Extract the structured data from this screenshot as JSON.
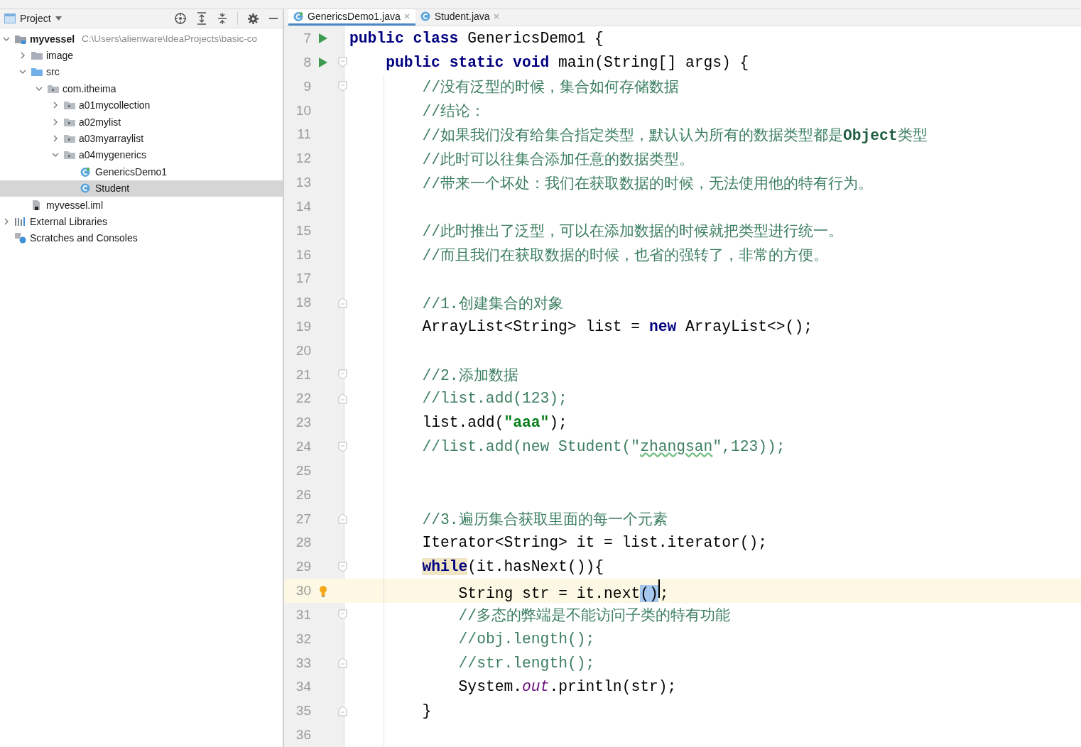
{
  "project_panel": {
    "title": "Project",
    "tree": [
      {
        "label": "myvessel",
        "kind": "module",
        "path": "C:\\Users\\alienware\\IdeaProjects\\basic-co",
        "expanded": true,
        "selected": false,
        "children": [
          {
            "label": "image",
            "kind": "folder",
            "expanded": false,
            "selected": false
          },
          {
            "label": "src",
            "kind": "source-folder",
            "expanded": true,
            "selected": false,
            "children": [
              {
                "label": "com.itheima",
                "kind": "package",
                "expanded": true,
                "selected": false,
                "children": [
                  {
                    "label": "a01mycollection",
                    "kind": "package",
                    "expanded": false,
                    "selected": false
                  },
                  {
                    "label": "a02mylist",
                    "kind": "package",
                    "expanded": false,
                    "selected": false
                  },
                  {
                    "label": "a03myarraylist",
                    "kind": "package",
                    "expanded": false,
                    "selected": false
                  },
                  {
                    "label": "a04mygenerics",
                    "kind": "package",
                    "expanded": true,
                    "selected": false,
                    "children": [
                      {
                        "label": "GenericsDemo1",
                        "kind": "main-class",
                        "selected": false
                      },
                      {
                        "label": "Student",
                        "kind": "class",
                        "selected": true
                      }
                    ]
                  }
                ]
              }
            ]
          },
          {
            "label": "myvessel.iml",
            "kind": "iml-file",
            "selected": false
          }
        ]
      },
      {
        "label": "External Libraries",
        "kind": "libraries",
        "expanded": false,
        "selected": false
      },
      {
        "label": "Scratches and Consoles",
        "kind": "scratches",
        "selected": false
      }
    ]
  },
  "tabs": [
    {
      "label": "GenericsDemo1.java",
      "kind": "main-class",
      "selected": true
    },
    {
      "label": "Student.java",
      "kind": "class",
      "selected": false
    }
  ],
  "editor": {
    "lines": [
      {
        "number": "7",
        "kind": "top",
        "gutter_icon": {
          "kind": "run"
        },
        "tokens": [
          {
            "kind": "keyword",
            "text": "public class"
          },
          {
            "kind": "plain",
            "text": " GenericsDemo1 {"
          }
        ]
      },
      {
        "number": "8",
        "kind": "member",
        "gutter_icon": {
          "kind": "run"
        },
        "fold_marker": {
          "kind": "start"
        },
        "tokens": [
          {
            "kind": "keyword",
            "text": "public static void"
          },
          {
            "kind": "plain",
            "text": " main(String[] args) {"
          }
        ]
      },
      {
        "number": "9",
        "kind": "body",
        "fold_marker": {
          "kind": "start"
        },
        "tokens": [
          {
            "kind": "comment",
            "text": "//没有泛型的时候，集合如何存储数据"
          }
        ]
      },
      {
        "number": "10",
        "kind": "body",
        "tokens": [
          {
            "kind": "comment",
            "text": "//结论："
          }
        ]
      },
      {
        "number": "11",
        "kind": "body",
        "tokens": [
          {
            "kind": "comment",
            "text": "//如果我们没有给集合指定类型，默认认为所有的数据类型都是"
          },
          {
            "kind": "comment-code",
            "text": "Object"
          },
          {
            "kind": "comment",
            "text": "类型"
          }
        ]
      },
      {
        "number": "12",
        "kind": "body",
        "tokens": [
          {
            "kind": "comment",
            "text": "//此时可以往集合添加任意的数据类型。"
          }
        ]
      },
      {
        "number": "13",
        "kind": "body",
        "tokens": [
          {
            "kind": "comment",
            "text": "//带来一个坏处：我们在获取数据的时候，无法使用他的特有行为。"
          }
        ]
      },
      {
        "number": "14"
      },
      {
        "number": "15",
        "kind": "body",
        "tokens": [
          {
            "kind": "comment",
            "text": "//此时推出了泛型，可以在添加数据的时候就把类型进行统一。"
          }
        ]
      },
      {
        "number": "16",
        "kind": "body",
        "tokens": [
          {
            "kind": "comment",
            "text": "//而且我们在获取数据的时候，也省的强转了，非常的方便。"
          }
        ]
      },
      {
        "number": "17"
      },
      {
        "number": "18",
        "kind": "body",
        "fold_marker": {
          "kind": "end"
        },
        "tokens": [
          {
            "kind": "comment",
            "text": "//1.创建集合的对象"
          }
        ]
      },
      {
        "number": "19",
        "kind": "body",
        "tokens": [
          {
            "kind": "plain",
            "text": "ArrayList<String> list = "
          },
          {
            "kind": "keyword",
            "text": "new"
          },
          {
            "kind": "plain",
            "text": " ArrayList<>();"
          }
        ]
      },
      {
        "number": "20"
      },
      {
        "number": "21",
        "kind": "body",
        "fold_marker": {
          "kind": "start"
        },
        "tokens": [
          {
            "kind": "comment",
            "text": "//2.添加数据"
          }
        ]
      },
      {
        "number": "22",
        "kind": "body",
        "fold_marker": {
          "kind": "end"
        },
        "tokens": [
          {
            "kind": "comment",
            "text": "//list.add(123);"
          }
        ]
      },
      {
        "number": "23",
        "kind": "body",
        "tokens": [
          {
            "kind": "plain",
            "text": "list.add("
          },
          {
            "kind": "string",
            "text": "\"aaa\""
          },
          {
            "kind": "plain",
            "text": ");"
          }
        ]
      },
      {
        "number": "24",
        "kind": "body",
        "fold_marker": {
          "kind": "start"
        },
        "tokens": [
          {
            "kind": "comment",
            "text": "//list.add(new Student(\""
          },
          {
            "kind": "comment-typo",
            "text": "zhangsan"
          },
          {
            "kind": "comment",
            "text": "\",123));"
          }
        ]
      },
      {
        "number": "25"
      },
      {
        "number": "26"
      },
      {
        "number": "27",
        "kind": "body",
        "fold_marker": {
          "kind": "end"
        },
        "tokens": [
          {
            "kind": "comment",
            "text": "//3.遍历集合获取里面的每一个元素"
          }
        ]
      },
      {
        "number": "28",
        "kind": "body",
        "tokens": [
          {
            "kind": "plain",
            "text": "Iterator<String> it = list.iterator();"
          }
        ]
      },
      {
        "number": "29",
        "kind": "body",
        "fold_marker": {
          "kind": "start"
        },
        "tokens": [
          {
            "kind": "keyword-match",
            "text": "while"
          },
          {
            "kind": "plain",
            "text": "(it.hasNext()){"
          }
        ]
      },
      {
        "number": "30",
        "kind": "loop-body",
        "current": true,
        "gutter_icon": {
          "kind": "bulb"
        },
        "tokens": [
          {
            "kind": "plain",
            "text": "String str = it.next"
          },
          {
            "kind": "selection",
            "text": "()",
            "caret": true
          },
          {
            "kind": "plain",
            "text": ";"
          }
        ]
      },
      {
        "number": "31",
        "kind": "loop-body",
        "fold_marker": {
          "kind": "start"
        },
        "tokens": [
          {
            "kind": "comment",
            "text": "//多态的弊端是不能访问子类的特有功能"
          }
        ]
      },
      {
        "number": "32",
        "kind": "loop-body",
        "tokens": [
          {
            "kind": "comment",
            "text": "//obj.length();"
          }
        ]
      },
      {
        "number": "33",
        "kind": "loop-body",
        "fold_marker": {
          "kind": "end"
        },
        "tokens": [
          {
            "kind": "comment",
            "text": "//str.length();"
          }
        ]
      },
      {
        "number": "34",
        "kind": "loop-body",
        "tokens": [
          {
            "kind": "plain",
            "text": "System."
          },
          {
            "kind": "static-field",
            "text": "out"
          },
          {
            "kind": "plain",
            "text": ".println(str);"
          }
        ]
      },
      {
        "number": "35",
        "kind": "body",
        "fold_marker": {
          "kind": "end"
        },
        "tokens": [
          {
            "kind": "plain",
            "text": "}"
          }
        ]
      },
      {
        "number": "36"
      }
    ]
  }
}
